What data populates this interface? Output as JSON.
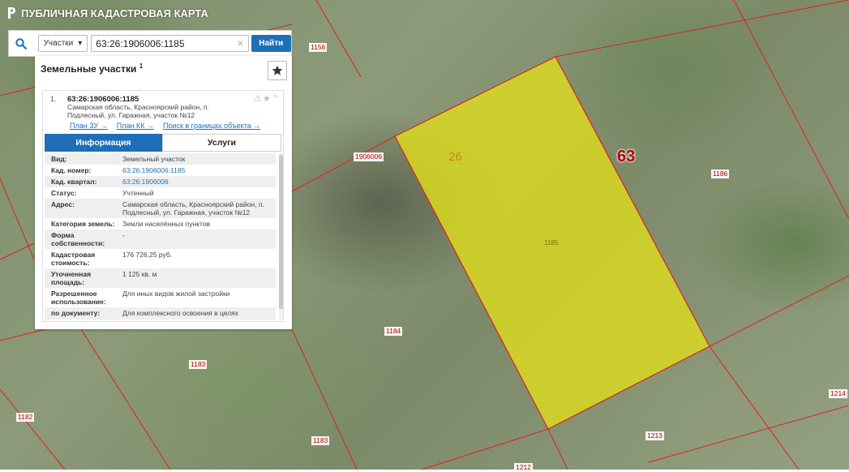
{
  "header": {
    "title": "ПУБЛИЧНАЯ КАДАСТРОВАЯ КАРТА"
  },
  "search": {
    "type_label": "Участки",
    "query": "63:26:1906006:1185",
    "clear_symbol": "×",
    "find_label": "Найти"
  },
  "panel": {
    "title": "Земельные участки",
    "count": "1",
    "item": {
      "index": "1.",
      "cad_number": "63:26:1906006:1185",
      "address": "Самарская область, Красноярский район, п. Подлесный, ул. Гаражная, участок №12",
      "links": [
        "План ЗУ →",
        "План КК →",
        "Поиск в границах объекта →"
      ]
    },
    "tabs": {
      "info": "Информация",
      "services": "Услуги"
    },
    "fields": [
      {
        "key": "Вид:",
        "value": "Земельный участок"
      },
      {
        "key": "Кад. номер:",
        "value": "63:26:1906006:1185",
        "link": true
      },
      {
        "key": "Кад. квартал:",
        "value": "63:26:1906006",
        "link": true
      },
      {
        "key": "Статус:",
        "value": "Учтенный"
      },
      {
        "key": "Адрес:",
        "value": "Самарская область, Красноярский район, п. Подлесный, ул. Гаражная, участок №12"
      },
      {
        "key": "Категория земель:",
        "value": "Земли населённых пунктов"
      },
      {
        "key": "Форма собственности:",
        "value": "-"
      },
      {
        "key": "Кадастровая стоимость:",
        "value": "176 726,25 руб."
      },
      {
        "key": "Уточненная площадь:",
        "value": "1 125 кв. м"
      },
      {
        "key": "Разрешенное использование:",
        "value": "Для иных видов жилой застройки"
      },
      {
        "key": "по документу:",
        "value": "Для комплексного освоения в целях жилищного строительства."
      }
    ]
  },
  "map": {
    "labels": {
      "l1156": "1156",
      "l1906006": "1906006",
      "l26": "26",
      "l63": "63",
      "l1186": "1186",
      "l1185": "1185",
      "l1184": "1184",
      "l1183a": "1183",
      "l1183b": "1183",
      "l1182": "1182",
      "l1213": "1213",
      "l1214": "1214",
      "l1212": "1212"
    },
    "colors": {
      "parcel_fill": "#dcdc1e",
      "boundary": "#e02020",
      "accent": "#1e6fb8"
    }
  }
}
